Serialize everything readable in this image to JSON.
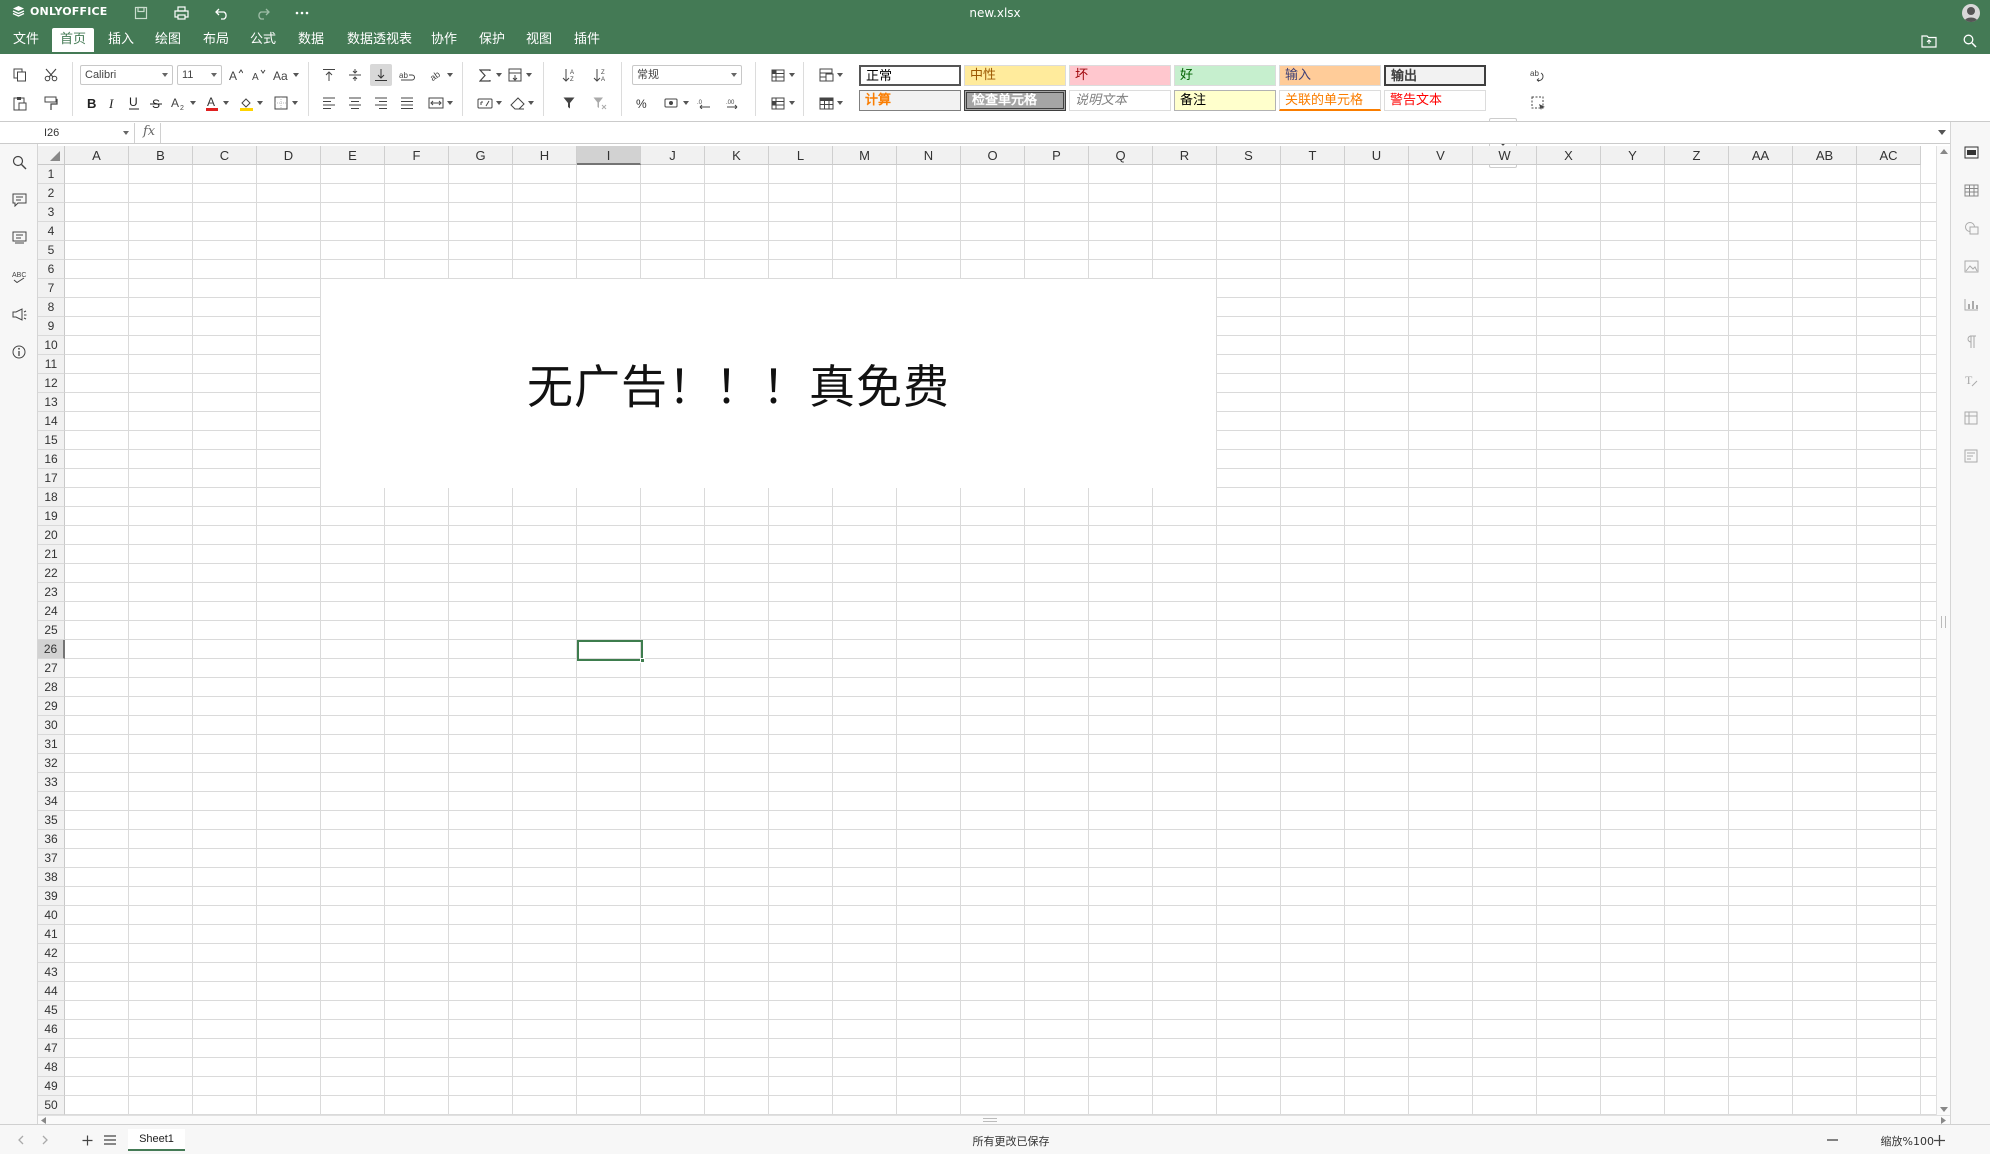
{
  "app": {
    "brand": "ONLYOFFICE",
    "doc_title": "new.xlsx",
    "accent_color": "#447a55"
  },
  "menu": {
    "tabs": [
      "文件",
      "首页",
      "插入",
      "绘图",
      "布局",
      "公式",
      "数据",
      "数据透视表",
      "协作",
      "保护",
      "视图",
      "插件"
    ],
    "active_tab": "首页"
  },
  "toolbar": {
    "font_name": "Calibri",
    "font_size": "11",
    "number_format": "常规"
  },
  "cell_styles": [
    {
      "label": "正常",
      "color": "#000000",
      "bg": "#ffffff"
    },
    {
      "label": "中性",
      "color": "#9c5700",
      "bg": "#ffeb9c"
    },
    {
      "label": "坏",
      "color": "#9c0006",
      "bg": "#ffc7ce"
    },
    {
      "label": "好",
      "color": "#006100",
      "bg": "#c6efce"
    },
    {
      "label": "输入",
      "color": "#3f3f76",
      "bg": "#ffcc99"
    },
    {
      "label": "输出",
      "color": "#3f3f3f",
      "bg": "#f2f2f2"
    },
    {
      "label": "计算",
      "color": "#fa7d00",
      "bg": "#f2f2f2"
    },
    {
      "label": "检查单元格",
      "color": "#ffffff",
      "bg": "#a5a5a5"
    },
    {
      "label": "说明文本",
      "color": "#7f7f7f",
      "bg": "#ffffff"
    },
    {
      "label": "备注",
      "color": "#000000",
      "bg": "#ffffcc"
    },
    {
      "label": "关联的单元格",
      "color": "#fa7d00",
      "bg": "#ffffff"
    },
    {
      "label": "警告文本",
      "color": "#ff0000",
      "bg": "#ffffff"
    }
  ],
  "formula_bar": {
    "name_box": "I26",
    "fx_label": "fx",
    "formula": ""
  },
  "grid": {
    "columns": [
      "A",
      "B",
      "C",
      "D",
      "E",
      "F",
      "G",
      "H",
      "I",
      "J",
      "K",
      "L",
      "M",
      "N",
      "O",
      "P",
      "Q",
      "R",
      "S",
      "T",
      "U",
      "V",
      "W",
      "X",
      "Y",
      "Z",
      "AA",
      "AB",
      "AC"
    ],
    "row_count": 50,
    "selected_cell": "I26",
    "selected_column": "I",
    "selected_row": 26
  },
  "banner": {
    "text": "无广告！！！真免费"
  },
  "status": {
    "sheet_tab": "Sheet1",
    "save_status": "所有更改已保存",
    "zoom": "缩放%100"
  }
}
